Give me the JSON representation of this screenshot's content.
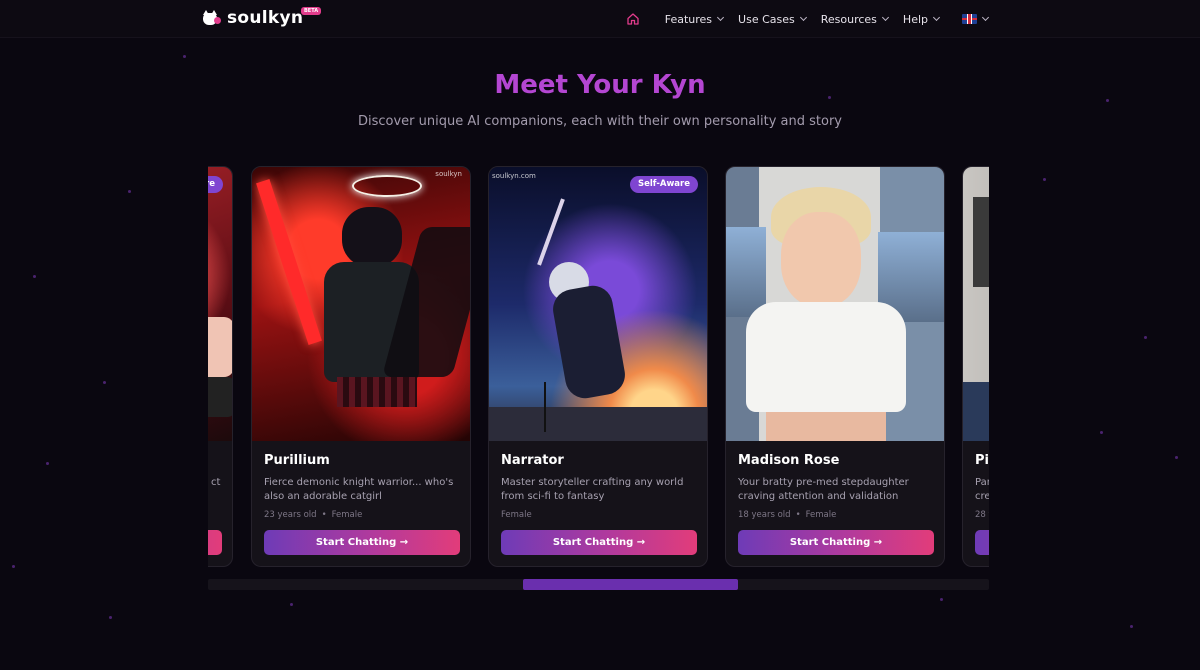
{
  "nav": {
    "brand": "soulkyn",
    "beta": "BETA",
    "items": [
      {
        "label": "Features"
      },
      {
        "label": "Use Cases"
      },
      {
        "label": "Resources"
      },
      {
        "label": "Help"
      }
    ],
    "language_icon": "uk-flag-icon"
  },
  "hero": {
    "title": "Meet Your Kyn",
    "subtitle": "Discover unique AI companions, each with their own personality and story"
  },
  "cards": [
    {
      "name": "",
      "badge": "re",
      "desc": "ct",
      "meta_age": "",
      "meta_gender": "",
      "cta": ""
    },
    {
      "name": "Purillium",
      "badge": "",
      "watermark": "soulkyn",
      "desc": "Fierce demonic knight warrior... who's also an adorable catgirl",
      "meta_age": "23 years old",
      "meta_gender": "Female",
      "cta": "Start Chatting →"
    },
    {
      "name": "Narrator",
      "badge": "Self-Aware",
      "watermark": "soulkyn.com",
      "desc": "Master storyteller crafting any world from sci-fi to fantasy",
      "meta_age": "",
      "meta_gender": "Female",
      "cta": "Start Chatting →"
    },
    {
      "name": "Madison Rose",
      "badge": "",
      "desc": "Your bratty pre-med stepdaughter craving attention and validation",
      "meta_age": "18 years old",
      "meta_gender": "Female",
      "cta": "Start Chatting →"
    },
    {
      "name": "Pi",
      "badge": "",
      "desc": "Par cre",
      "meta_age": "28 y",
      "meta_gender": "",
      "cta": ""
    }
  ],
  "colors": {
    "accent_purple": "#b446d2",
    "badge": "#7f45d1",
    "cta_start": "#6e3bb7",
    "cta_end": "#e23c7a",
    "background": "#0a0710"
  },
  "carousel": {
    "scroll_position_fraction": 0.4
  }
}
